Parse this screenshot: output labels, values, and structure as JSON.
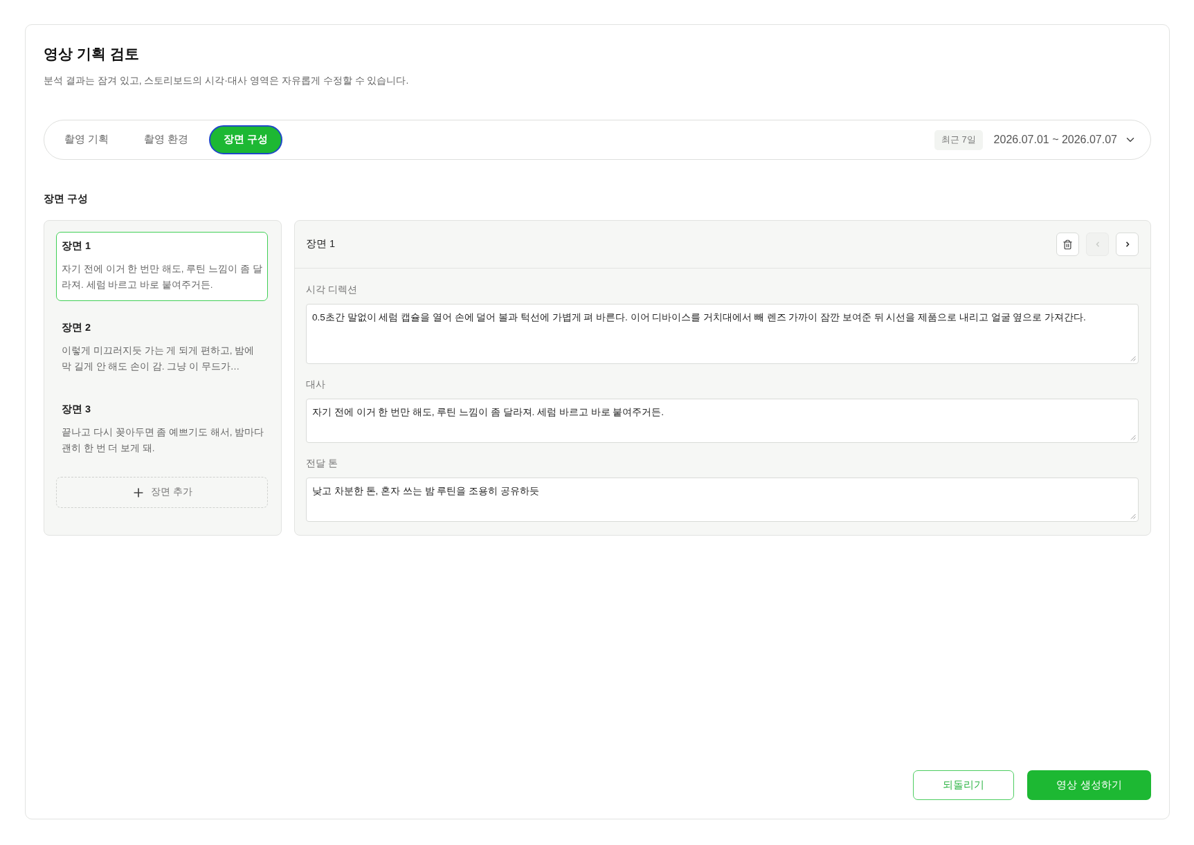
{
  "page": {
    "title": "영상 기획 검토",
    "subtitle": "분석 결과는 잠겨 있고, 스토리보드의 시각·대사 영역은 자유롭게 수정할 수 있습니다."
  },
  "tabs": [
    {
      "label": "촬영 기획",
      "selected": false
    },
    {
      "label": "촬영 환경",
      "selected": false
    },
    {
      "label": "장면 구성",
      "selected": true
    }
  ],
  "date_range": {
    "badge": "최근 7일",
    "value": "2026.07.01 ~ 2026.07.07"
  },
  "section_title": "장면 구성",
  "scenes": [
    {
      "title": "장면 1",
      "excerpt": "자기 전에 이거 한 번만 해도, 루틴 느낌이 좀 달라져. 세럼 바르고 바로 붙여주거든.",
      "selected": true
    },
    {
      "title": "장면 2",
      "excerpt": "이렇게 미끄러지듯 가는 게 되게 편하고, 밤에 막 길게 안 해도 손이 감. 그냥 이 무드가…",
      "selected": false
    },
    {
      "title": "장면 3",
      "excerpt": "끝나고 다시 꽂아두면 좀 예쁘기도 해서, 밤마다 괜히 한 번 더 보게 돼.",
      "selected": false
    }
  ],
  "add_scene_button": "장면 추가",
  "editor": {
    "title": "장면 1",
    "toolbar": [
      {
        "kind": "delete",
        "disabled": false
      },
      {
        "kind": "prev",
        "disabled": true
      },
      {
        "kind": "next",
        "disabled": false
      }
    ],
    "fields": [
      {
        "label": "시각 디렉션",
        "value": "0.5초간 말없이 세럼 캡슐을 열어 손에 덜어 볼과 턱선에 가볍게 펴 바른다. 이어 디바이스를 거치대에서 빼 렌즈 가까이 잠깐 보여준 뒤 시선을 제품으로 내리고 얼굴 옆으로 가져간다.",
        "kind": "tall"
      },
      {
        "label": "대사",
        "value": "자기 전에 이거 한 번만 해도, 루틴 느낌이 좀 달라져. 세럼 바르고 바로 붙여주거든.",
        "kind": "short"
      },
      {
        "label": "전달 톤",
        "value": "낮고 차분한 톤, 혼자 쓰는 밤 루틴을 조용히 공유하듯",
        "kind": "short"
      }
    ]
  },
  "buttons": [
    {
      "label": "되돌리기",
      "kind": "outline"
    },
    {
      "label": "영상 생성하기",
      "kind": "primary"
    }
  ]
}
